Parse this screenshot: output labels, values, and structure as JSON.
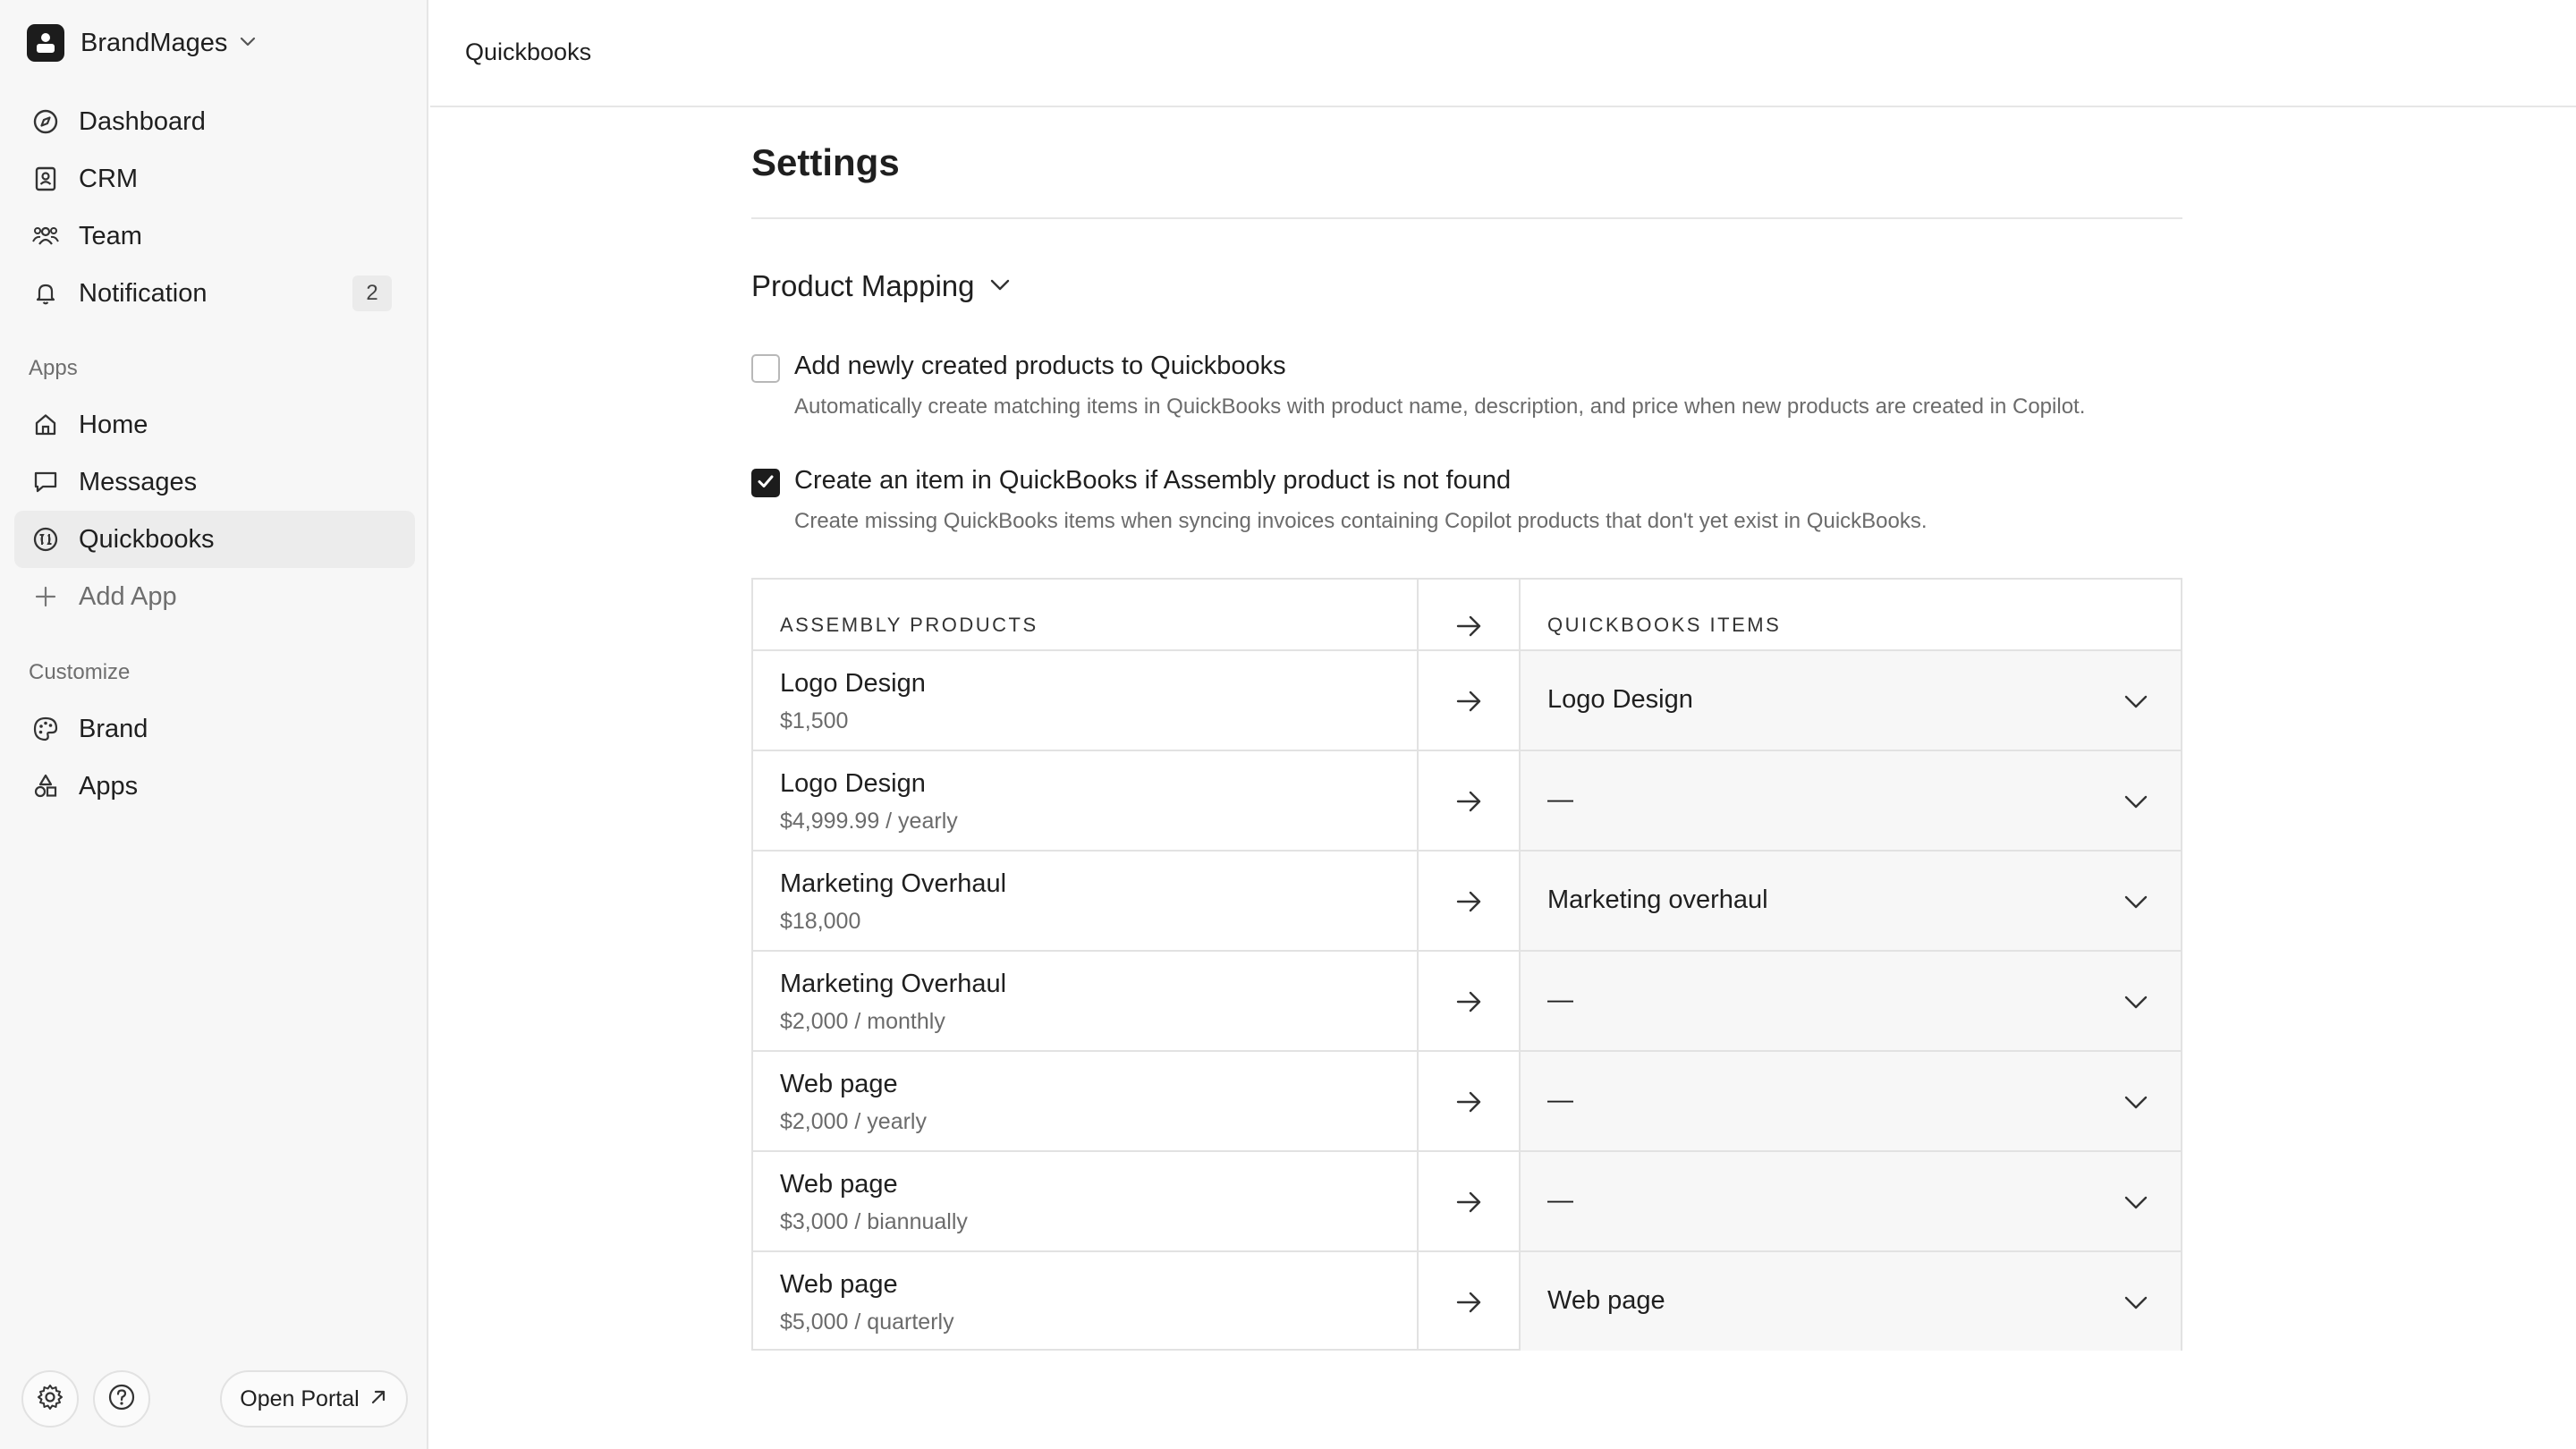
{
  "sidebar": {
    "workspace_name": "BrandMages",
    "nav": [
      {
        "label": "Dashboard",
        "icon": "compass-icon"
      },
      {
        "label": "CRM",
        "icon": "contact-card-icon"
      },
      {
        "label": "Team",
        "icon": "team-icon"
      },
      {
        "label": "Notification",
        "icon": "bell-icon",
        "badge": "2"
      }
    ],
    "apps_label": "Apps",
    "apps": [
      {
        "label": "Home",
        "icon": "home-icon"
      },
      {
        "label": "Messages",
        "icon": "message-icon"
      },
      {
        "label": "Quickbooks",
        "icon": "quickbooks-icon",
        "active": true
      },
      {
        "label": "Add App",
        "icon": "plus-icon"
      }
    ],
    "customize_label": "Customize",
    "customize": [
      {
        "label": "Brand",
        "icon": "palette-icon"
      },
      {
        "label": "Apps",
        "icon": "shapes-icon"
      }
    ],
    "open_portal_label": "Open Portal"
  },
  "header": {
    "breadcrumb": "Quickbooks"
  },
  "main": {
    "title": "Settings",
    "section_title": "Product Mapping",
    "options": [
      {
        "label": "Add newly created products to Quickbooks",
        "description": "Automatically create matching items in QuickBooks with product name, description, and price when new products are created in Copilot.",
        "checked": false
      },
      {
        "label": "Create an item in QuickBooks if Assembly product is not found",
        "description": "Create missing QuickBooks items when syncing invoices containing Copilot products that don't yet exist in QuickBooks.",
        "checked": true
      }
    ],
    "table": {
      "col_left": "ASSEMBLY PRODUCTS",
      "col_right": "QUICKBOOKS ITEMS",
      "rows": [
        {
          "name": "Logo Design",
          "price": "$1,500",
          "mapped": "Logo Design"
        },
        {
          "name": "Logo Design",
          "price": "$4,999.99 / yearly",
          "mapped": "—"
        },
        {
          "name": "Marketing Overhaul",
          "price": "$18,000",
          "mapped": "Marketing overhaul"
        },
        {
          "name": "Marketing Overhaul",
          "price": "$2,000 / monthly",
          "mapped": "—"
        },
        {
          "name": "Web page",
          "price": "$2,000 / yearly",
          "mapped": "—"
        },
        {
          "name": "Web page",
          "price": "$3,000 / biannually",
          "mapped": "—"
        },
        {
          "name": "Web page",
          "price": "$5,000 / quarterly",
          "mapped": "Web page"
        }
      ]
    }
  },
  "colors": {
    "accent": "#1c1c1c",
    "sidebar_bg": "#f7f7f7",
    "border": "#e2e2e2",
    "muted_text": "#6b6b6b"
  }
}
